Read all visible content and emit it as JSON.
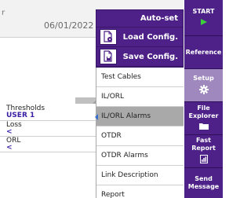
{
  "background": {
    "header_letter": "r",
    "date": "06/01/2022 1",
    "table": [
      {
        "label": "Thresholds",
        "value": "USER 1"
      },
      {
        "label": "Loss",
        "value": "<"
      },
      {
        "label": "ORL",
        "value": "<"
      }
    ]
  },
  "menu": {
    "dark_items": [
      {
        "label": "Auto-set",
        "icon": ""
      },
      {
        "label": "Load Config.",
        "icon": "load-config-icon"
      },
      {
        "label": "Save Config.",
        "icon": "save-config-icon"
      }
    ],
    "items": [
      {
        "label": "Test Cables"
      },
      {
        "label": "IL/ORL"
      },
      {
        "label": "IL/ORL Alarms",
        "selected": true
      },
      {
        "label": "OTDR"
      },
      {
        "label": "OTDR Alarms"
      },
      {
        "label": "Link Description"
      },
      {
        "label": "Report"
      }
    ]
  },
  "sidebar": {
    "start": "START",
    "reference": "Reference",
    "setup": "Setup",
    "file_explorer_1": "File",
    "file_explorer_2": "Explorer",
    "fast_report_1": "Fast",
    "fast_report_2": "Report",
    "send_message_1": "Send",
    "send_message_2": "Message"
  },
  "colors": {
    "brand_purple": "#4e2188",
    "active_button": "#9e88be",
    "start_arrow": "#3bd13b",
    "value_text": "#3a1fa6"
  }
}
